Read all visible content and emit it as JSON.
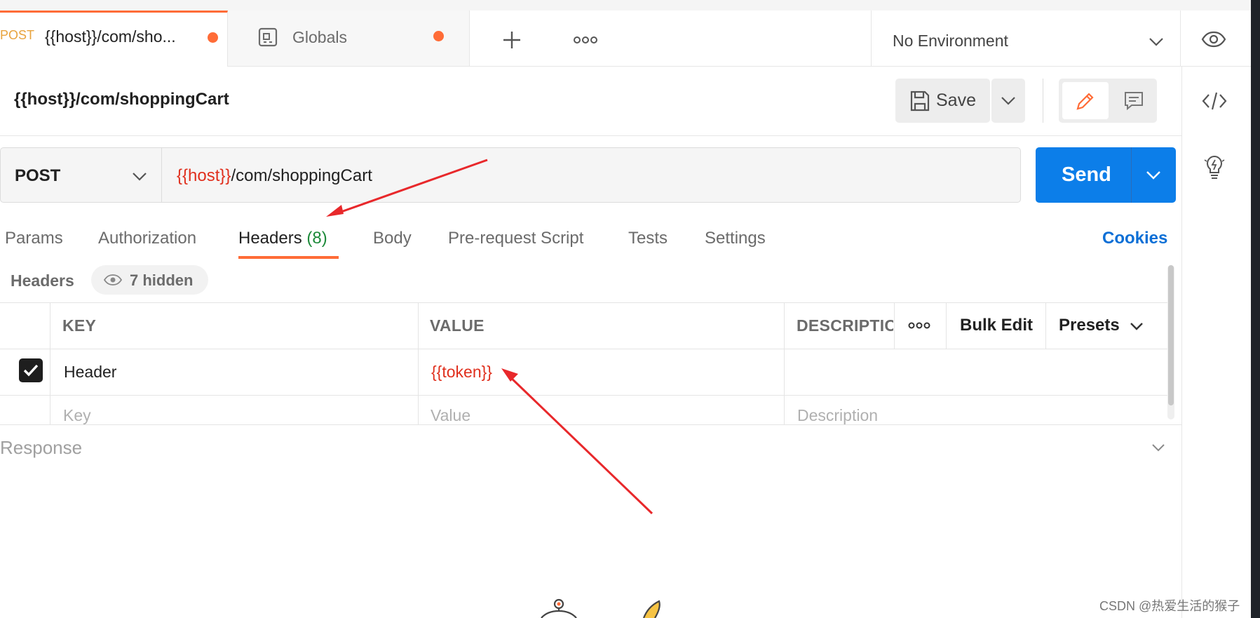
{
  "tabs": [
    {
      "method": "POST",
      "title": "{{host}}/com/sho..."
    },
    {
      "title": "Globals"
    }
  ],
  "environment": {
    "selected": "No Environment"
  },
  "request": {
    "title": "{{host}}/com/shoppingCart",
    "method": "POST",
    "url_var": "{{host}}",
    "url_path": "/com/shoppingCart"
  },
  "toolbar": {
    "save_label": "Save",
    "send_label": "Send"
  },
  "request_tabs": {
    "params": "Params",
    "authorization": "Authorization",
    "headers": "Headers",
    "headers_count": "(8)",
    "body": "Body",
    "prerequest": "Pre-request Script",
    "tests": "Tests",
    "settings": "Settings",
    "cookies": "Cookies"
  },
  "headers_section": {
    "label": "Headers",
    "hidden_label": "7 hidden",
    "columns": {
      "key": "KEY",
      "value": "VALUE",
      "description": "DESCRIPTIC"
    },
    "bulk_edit": "Bulk Edit",
    "presets": "Presets",
    "rows": [
      {
        "checked": true,
        "key": "Header",
        "value": "{{token}}",
        "description": ""
      }
    ],
    "placeholders": {
      "key": "Key",
      "value": "Value",
      "description": "Description"
    }
  },
  "response": {
    "label": "Response"
  },
  "watermark": "CSDN @热爱生活的猴子",
  "colors": {
    "accent_orange": "#ff6c37",
    "send_blue": "#0c7ee9",
    "variable_red": "#e0301e",
    "count_green": "#1d8a3a",
    "annotation_arrow": "#e8282b"
  }
}
